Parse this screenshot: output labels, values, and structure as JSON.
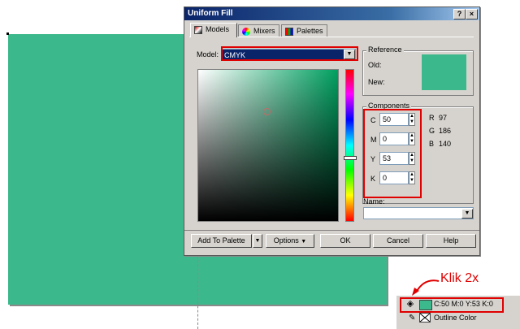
{
  "dialog": {
    "title": "Uniform Fill",
    "help_glyph": "?",
    "close_glyph": "×",
    "tabs": [
      {
        "label": "Models"
      },
      {
        "label": "Mixers"
      },
      {
        "label": "Palettes"
      }
    ],
    "model_label": "Model:",
    "model_value": "CMYK",
    "reference": {
      "title": "Reference",
      "old_label": "Old:",
      "new_label": "New:",
      "swatch_color": "#3cb98c"
    },
    "components": {
      "title": "Components",
      "cmyk": [
        {
          "label": "C",
          "value": "50"
        },
        {
          "label": "M",
          "value": "0"
        },
        {
          "label": "Y",
          "value": "53"
        },
        {
          "label": "K",
          "value": "0"
        }
      ],
      "rgb": [
        {
          "label": "R",
          "value": "97"
        },
        {
          "label": "G",
          "value": "186"
        },
        {
          "label": "B",
          "value": "140"
        }
      ]
    },
    "name_label": "Name:",
    "name_value": "",
    "buttons": {
      "add_to_palette": "Add To Palette",
      "options": "Options",
      "ok": "OK",
      "cancel": "Cancel",
      "help": "Help"
    }
  },
  "statusbar": {
    "fill_text": "C:50 M:0 Y:53 K:0",
    "fill_color": "#3cb98c",
    "outline_text": "Outline Color"
  },
  "annotation": {
    "text": "Klik 2x",
    "color": "#e00000"
  },
  "canvas": {
    "fill_color": "#3cb98c"
  }
}
